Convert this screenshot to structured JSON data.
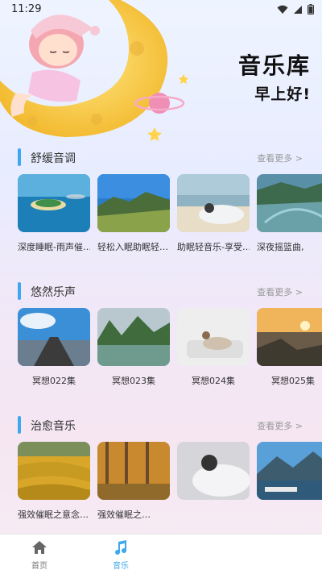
{
  "status_bar": {
    "time": "11:29"
  },
  "header": {
    "title": "音乐库",
    "greeting": "早上好!"
  },
  "sections": [
    {
      "title": "舒缓音调",
      "more": "查看更多 >",
      "items": [
        {
          "label": "深度睡眠-雨声催…"
        },
        {
          "label": "轻松入眠助眠轻…"
        },
        {
          "label": "助眠轻音乐-享受…"
        },
        {
          "label": "深夜摇篮曲,"
        }
      ]
    },
    {
      "title": "悠然乐声",
      "more": "查看更多 >",
      "items": [
        {
          "label": "冥想022集"
        },
        {
          "label": "冥想023集"
        },
        {
          "label": "冥想024集"
        },
        {
          "label": "冥想025集"
        }
      ]
    },
    {
      "title": "治愈音乐",
      "more": "查看更多 >",
      "items": [
        {
          "label": "强效催眠之意念…"
        },
        {
          "label": "强效催眠之…"
        },
        {
          "label": ""
        },
        {
          "label": ""
        }
      ]
    }
  ],
  "bottom_nav": {
    "home": {
      "label": "首页",
      "icon": "home-icon"
    },
    "music": {
      "label": "音乐",
      "icon": "music-note-icon",
      "active": true
    }
  },
  "colors": {
    "accent": "#3ea7ef"
  }
}
